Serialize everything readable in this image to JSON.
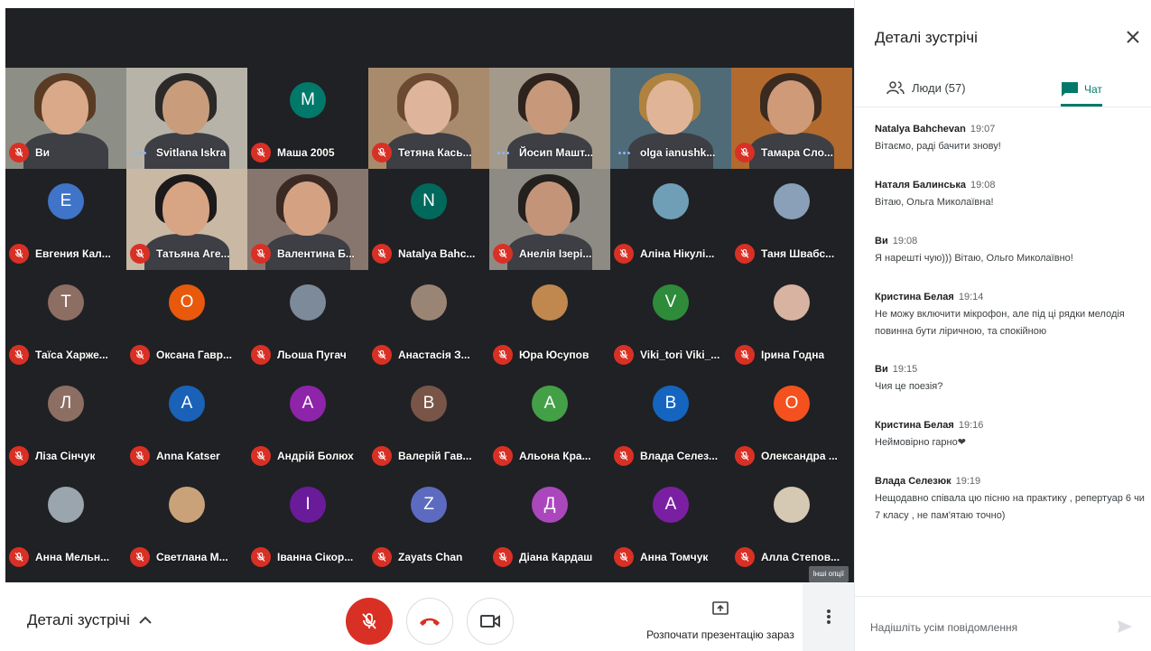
{
  "colors": {
    "mic_off": "#d93025",
    "accent": "#00796b",
    "tile_bg": "#3c4043",
    "stage_bg": "#1f2124"
  },
  "participants": [
    {
      "name": "Ви",
      "status": "mic-off",
      "kind": "video",
      "skin": "#d9a98a",
      "hair": "#5a3b24",
      "bg": "#8d8f86"
    },
    {
      "name": "Svitlana Iskra",
      "status": "speaking",
      "kind": "video",
      "skin": "#c99c7c",
      "hair": "#2b2a29",
      "bg": "#b8b3a8"
    },
    {
      "name": "Маша 2005",
      "status": "mic-off",
      "kind": "avatar",
      "initial": "M",
      "color": "#00796b"
    },
    {
      "name": "Тетяна Кась...",
      "status": "mic-off",
      "kind": "video",
      "skin": "#deb59b",
      "hair": "#6b4a31",
      "bg": "#a88b6c"
    },
    {
      "name": "Йосип Машт...",
      "status": "speaking",
      "kind": "video",
      "skin": "#c8987a",
      "hair": "#2e241d",
      "bg": "#a39a8c"
    },
    {
      "name": "olga ianushk...",
      "status": "speaking-active",
      "kind": "video",
      "skin": "#e0b496",
      "hair": "#b0823f",
      "bg": "#4f6b77"
    },
    {
      "name": "Тамара Сло...",
      "status": "mic-off",
      "kind": "video",
      "skin": "#cf9a78",
      "hair": "#3b2a20",
      "bg": "#b26a2e"
    },
    {
      "name": "Евгения Кал...",
      "status": "mic-off",
      "kind": "avatar",
      "initial": "E",
      "color": "#3f74c9"
    },
    {
      "name": "Татьяна Аге...",
      "status": "mic-off",
      "kind": "video",
      "skin": "#d7a484",
      "hair": "#1c1a1a",
      "bg": "#c9b8a4"
    },
    {
      "name": "Валентина Б...",
      "status": "mic-off",
      "kind": "video",
      "skin": "#d4a283",
      "hair": "#3a2a23",
      "bg": "#87766e"
    },
    {
      "name": "Natalya Bahc...",
      "status": "mic-off",
      "kind": "avatar",
      "initial": "N",
      "color": "#00695c"
    },
    {
      "name": "Анелія Ізері...",
      "status": "mic-off",
      "kind": "video",
      "skin": "#c49479",
      "hair": "#23201e",
      "bg": "#8e8b84"
    },
    {
      "name": "Аліна Нікулі...",
      "status": "mic-off",
      "kind": "photo",
      "color": "#6f9fb7"
    },
    {
      "name": "Таня Швабс...",
      "status": "mic-off",
      "kind": "photo",
      "color": "#8aa0b8"
    },
    {
      "name": "Таїса Харже...",
      "status": "mic-off",
      "kind": "avatar",
      "initial": "T",
      "color": "#8d6e63"
    },
    {
      "name": "Оксана Гавр...",
      "status": "mic-off",
      "kind": "avatar",
      "initial": "O",
      "color": "#e8590c"
    },
    {
      "name": "Льоша Пугач",
      "status": "mic-off",
      "kind": "photo",
      "color": "#7d8a99"
    },
    {
      "name": "Анастасія З...",
      "status": "mic-off",
      "kind": "photo",
      "color": "#9a8575"
    },
    {
      "name": "Юра Юсупов",
      "status": "mic-off",
      "kind": "photo",
      "color": "#c0884f"
    },
    {
      "name": "Viki_tori Viki_...",
      "status": "mic-off",
      "kind": "avatar",
      "initial": "V",
      "color": "#2e8b3a"
    },
    {
      "name": "Ірина Годна",
      "status": "mic-off",
      "kind": "photo",
      "color": "#d8b3a1"
    },
    {
      "name": "Ліза Сінчук",
      "status": "mic-off",
      "kind": "avatar",
      "initial": "Л",
      "color": "#8d6e63"
    },
    {
      "name": "Anna Katser",
      "status": "mic-off",
      "kind": "avatar",
      "initial": "A",
      "color": "#1a62b8"
    },
    {
      "name": "Андрій Болюх",
      "status": "mic-off",
      "kind": "avatar",
      "initial": "A",
      "color": "#8e24aa"
    },
    {
      "name": "Валерій Гав...",
      "status": "mic-off",
      "kind": "avatar",
      "initial": "B",
      "color": "#795548"
    },
    {
      "name": "Альона Кра...",
      "status": "mic-off",
      "kind": "avatar",
      "initial": "A",
      "color": "#43a047"
    },
    {
      "name": "Влада Селез...",
      "status": "mic-off",
      "kind": "avatar",
      "initial": "B",
      "color": "#1565c0"
    },
    {
      "name": "Олександра ...",
      "status": "mic-off",
      "kind": "avatar",
      "initial": "O",
      "color": "#f4511e"
    },
    {
      "name": "Анна Мельн...",
      "status": "mic-off",
      "kind": "photo",
      "color": "#9aa5ad"
    },
    {
      "name": "Светлана М...",
      "status": "mic-off",
      "kind": "photo",
      "color": "#c9a27a"
    },
    {
      "name": "Іванна Сікор...",
      "status": "mic-off",
      "kind": "avatar",
      "initial": "I",
      "color": "#6a1b9a"
    },
    {
      "name": "Zayats Chan",
      "status": "mic-off",
      "kind": "avatar",
      "initial": "Z",
      "color": "#5c6bc0"
    },
    {
      "name": "Діана Кардаш",
      "status": "mic-off",
      "kind": "avatar",
      "initial": "Д",
      "color": "#ab47bc"
    },
    {
      "name": "Анна Томчук",
      "status": "mic-off",
      "kind": "avatar",
      "initial": "A",
      "color": "#7b1fa2"
    },
    {
      "name": "Алла Степов...",
      "status": "mic-off",
      "kind": "photo",
      "color": "#d6c9b3"
    }
  ],
  "stage": {
    "more_options_tooltip": "Інші опції"
  },
  "bottombar": {
    "details_label": "Деталі зустрічі",
    "present_label": "Розпочати презентацію зараз",
    "mic_icon": "mic-off-icon",
    "hangup_icon": "phone-hangup-icon",
    "camera_icon": "camera-icon",
    "more_icon": "more-vert-icon"
  },
  "panel": {
    "title": "Деталі зустрічі",
    "tab_people": "Люди (57)",
    "tab_chat": "Чат",
    "compose_placeholder": "Надішліть усім повідомлення",
    "messages": [
      {
        "sender": "Natalya Bahchevan",
        "time": "19:07",
        "text": "Вітаємо, раді бачити знову!"
      },
      {
        "sender": "Наталя Балинська",
        "time": "19:08",
        "text": "Вітаю, Ольга Миколаївна!"
      },
      {
        "sender": "Ви",
        "time": "19:08",
        "text": "Я нарешті чую))) Вітаю, Ольго Миколаївно!"
      },
      {
        "sender": "Кристина Белая",
        "time": "19:14",
        "text": "Не можу включити мікрофон, але під ці рядки мелодія повинна бути ліричною, та спокійною"
      },
      {
        "sender": "Ви",
        "time": "19:15",
        "text": "Чия це поезія?"
      },
      {
        "sender": "Кристина Белая",
        "time": "19:16",
        "text": "Неймовірно гарно❤"
      },
      {
        "sender": "Влада Селезюк",
        "time": "19:19",
        "text": "Нещодавно співала цю пісню на практику , репертуар 6 чи 7 класу , не пам'ятаю точно)"
      }
    ]
  }
}
